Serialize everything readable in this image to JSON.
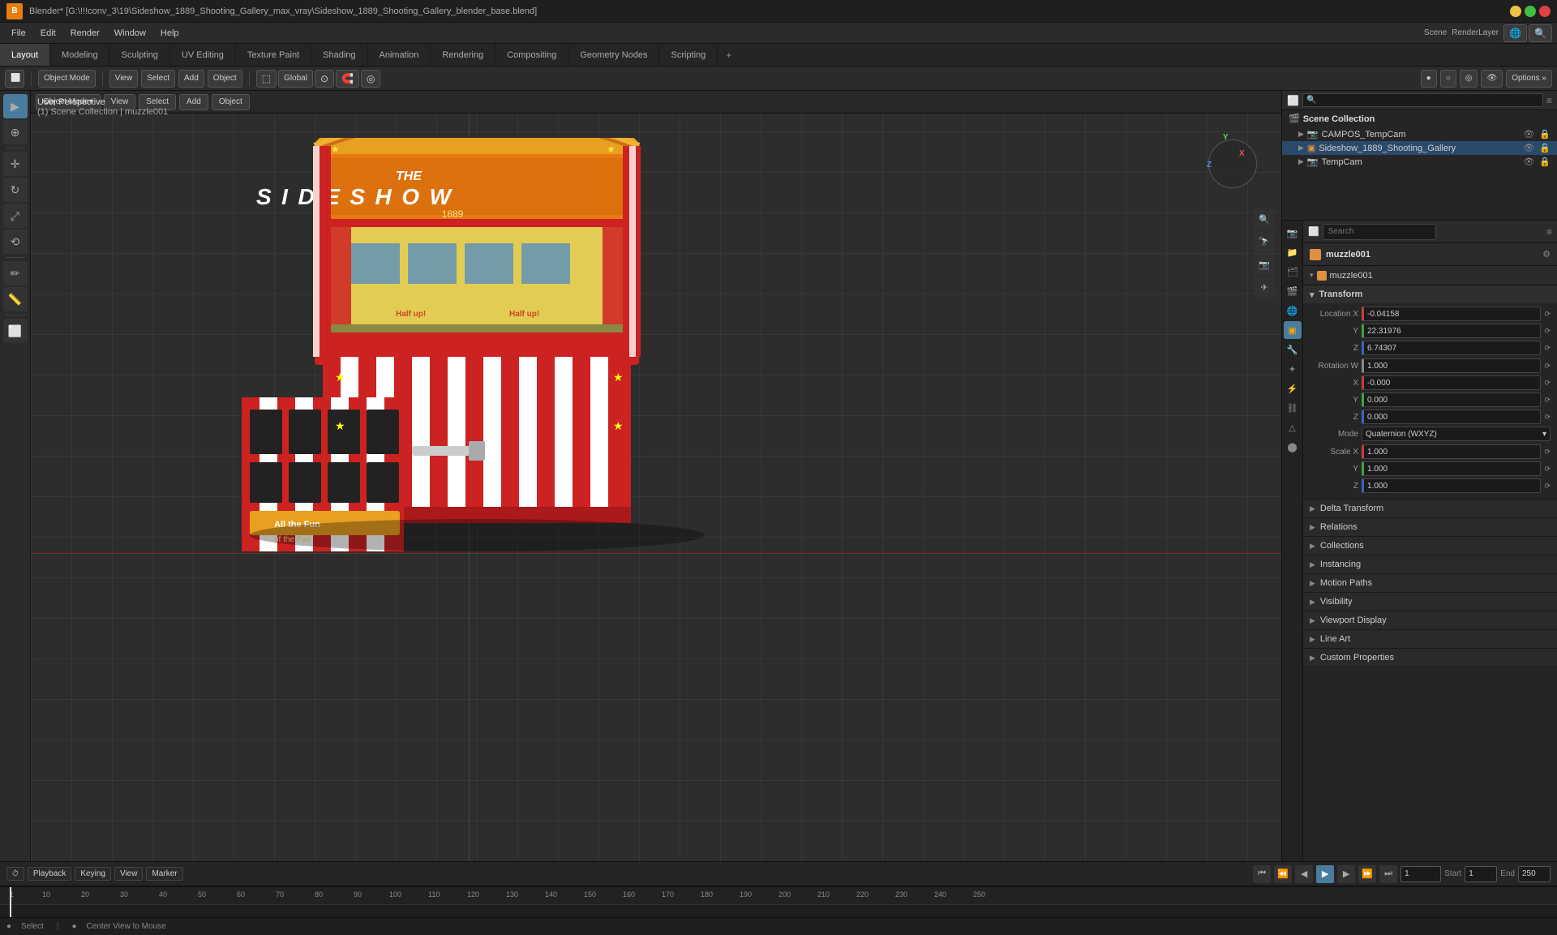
{
  "titlebar": {
    "title": "Blender* [G:\\!!!conv_3\\19\\Sideshow_1889_Shooting_Gallery_max_vray\\Sideshow_1889_Shooting_Gallery_blender_base.blend]",
    "app_name": "Blender*"
  },
  "menubar": {
    "items": [
      "File",
      "Edit",
      "Render",
      "Window",
      "Help"
    ]
  },
  "workspaces": {
    "tabs": [
      "Layout",
      "Modeling",
      "Sculpting",
      "UV Editing",
      "Texture Paint",
      "Shading",
      "Animation",
      "Rendering",
      "Compositing",
      "Geometry Nodes",
      "Scripting"
    ],
    "active": "Layout",
    "plus": "+"
  },
  "header_toolbar": {
    "mode": "Object Mode",
    "view": "View",
    "select": "Select",
    "add": "Add",
    "object": "Object",
    "global": "Global",
    "transform_pivot": "Individual Origins",
    "snap": "Snap",
    "proportional": "Proportional",
    "options": "Options »"
  },
  "viewport": {
    "info_line1": "User Perspective",
    "info_line2": "(1) Scene Collection | muzzle001",
    "header": {
      "mode": "Object Mode",
      "view": "View",
      "select": "Select",
      "add": "Add",
      "object": "Object"
    }
  },
  "nav_gizmo": {
    "x": "X",
    "y": "Y",
    "z": "Z"
  },
  "outliner": {
    "title": "Scene",
    "scene_collection": "Scene Collection",
    "items": [
      {
        "name": "CAMPOS_TempCam",
        "indent": 1
      },
      {
        "name": "Sideshow_1889_Shooting_Gallery",
        "indent": 1,
        "active": true
      },
      {
        "name": "TempCam",
        "indent": 1
      }
    ]
  },
  "properties": {
    "active_object": "muzzle001",
    "sub_object": "muzzle001",
    "search_placeholder": "Search",
    "tabs": [
      "scene",
      "render",
      "output",
      "view_layer",
      "scene2",
      "world",
      "object",
      "modifier",
      "particles",
      "physics",
      "constraints",
      "object_data",
      "material",
      "shader"
    ],
    "transform": {
      "title": "Transform",
      "location": {
        "x": "-0.04158",
        "y": "22.31976",
        "z": "6.74307"
      },
      "rotation": {
        "w": "1.000",
        "x": "-0.000",
        "y": "0.000",
        "z": "0.000"
      },
      "rotation_mode": {
        "label": "Mode",
        "value": "Quaternion (WXYZ)"
      },
      "scale": {
        "x": "1.000",
        "y": "1.000",
        "z": "1.000"
      }
    },
    "sections": [
      {
        "id": "delta_transform",
        "label": "Delta Transform",
        "expanded": false
      },
      {
        "id": "relations",
        "label": "Relations",
        "expanded": false
      },
      {
        "id": "collections",
        "label": "Collections",
        "expanded": false
      },
      {
        "id": "instancing",
        "label": "Instancing",
        "expanded": false
      },
      {
        "id": "motion_paths",
        "label": "Motion Paths",
        "expanded": false
      },
      {
        "id": "visibility",
        "label": "Visibility",
        "expanded": false
      },
      {
        "id": "viewport_display",
        "label": "Viewport Display",
        "expanded": false
      },
      {
        "id": "line_art",
        "label": "Line Art",
        "expanded": false
      },
      {
        "id": "custom_properties",
        "label": "Custom Properties",
        "expanded": false
      }
    ]
  },
  "timeline": {
    "controls": {
      "playback": "Playback",
      "keying": "Keying",
      "view": "View",
      "marker": "Marker"
    },
    "frame_start": "1",
    "frame_end": "250",
    "current_frame": "1",
    "start_label": "Start",
    "end_label": "End",
    "frame_numbers": [
      "1",
      "10",
      "20",
      "30",
      "40",
      "50",
      "60",
      "70",
      "80",
      "90",
      "100",
      "110",
      "120",
      "130",
      "140",
      "150",
      "160",
      "170",
      "180",
      "190",
      "200",
      "210",
      "220",
      "230",
      "240",
      "250"
    ]
  },
  "statusbar": {
    "select": "Select",
    "center_view": "Center View to Mouse",
    "icon": "●"
  },
  "colors": {
    "accent_blue": "#4a7c9e",
    "accent_orange": "#e09040",
    "x_axis": "#c04040",
    "y_axis": "#40a040",
    "z_axis": "#4060c0",
    "bg_dark": "#252525",
    "bg_darker": "#1e1e1e"
  },
  "icons": {
    "cursor": "⊕",
    "move": "✛",
    "rotate": "↻",
    "scale": "⤢",
    "transform": "⟲",
    "select": "▶",
    "box_select": "⬜",
    "measure": "📏",
    "annotate": "✏",
    "view_point": "👁",
    "camera": "📷",
    "dot": "•",
    "triangle_right": "▶",
    "triangle_down": "▾",
    "arrow_right": "›",
    "scene_icon": "🎬",
    "object_icon": "▣",
    "eye": "👁",
    "lock": "🔒",
    "render": "📷",
    "output": "📁",
    "view_layer": "🗂",
    "world": "🌐",
    "object": "▣",
    "modifier": "🔧",
    "material": "⬤",
    "particles": "✦",
    "physics": "⚡",
    "constraints": "⛓",
    "object_data": "△",
    "shader": "⬤",
    "expand_icon": "▶",
    "collapse_icon": "▼",
    "chevron_right": "›",
    "chevron_down": "⌄"
  }
}
